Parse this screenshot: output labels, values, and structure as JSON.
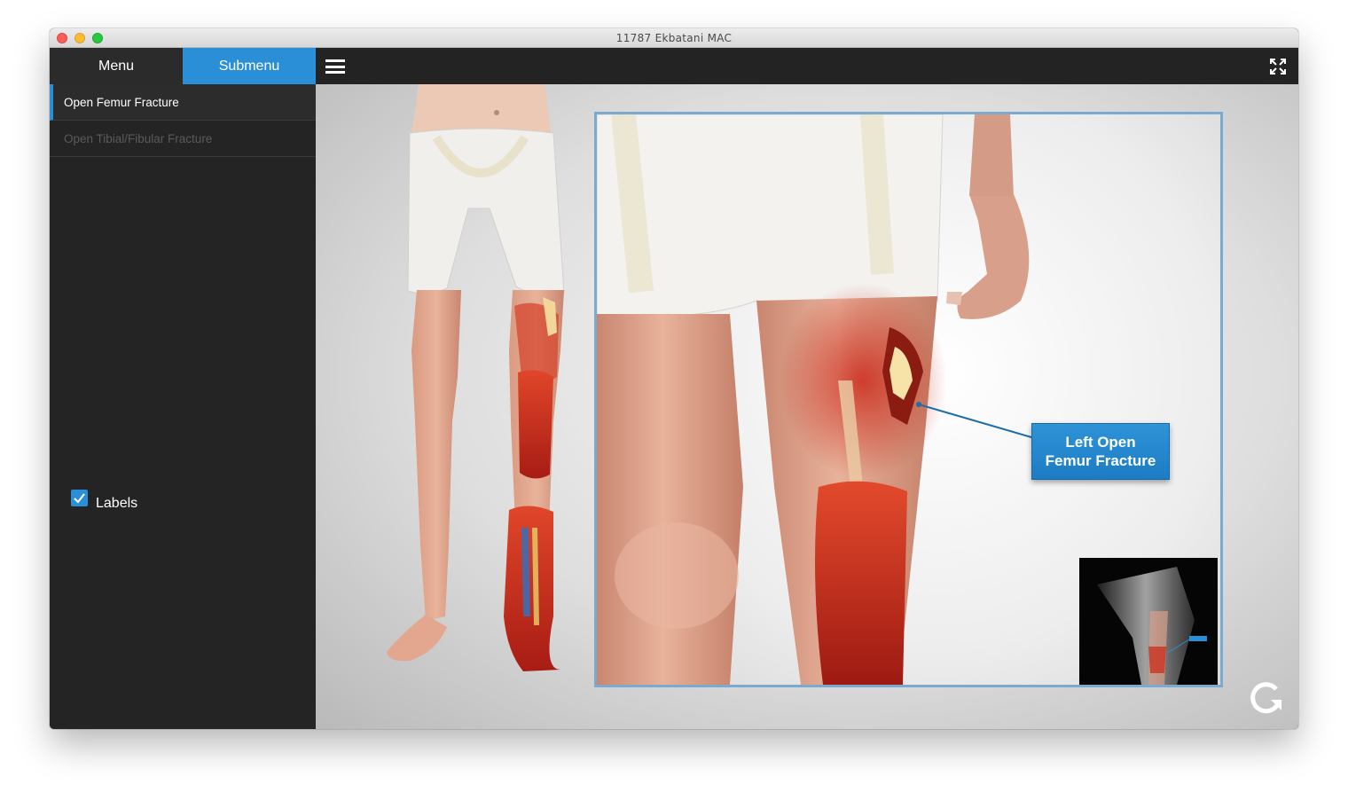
{
  "window": {
    "title": "11787 Ekbatani MAC"
  },
  "tabs": {
    "menu_label": "Menu",
    "submenu_label": "Submenu"
  },
  "sidebar": {
    "items": [
      {
        "label": "Open Femur Fracture",
        "state": "active"
      },
      {
        "label": "Open Tibial/Fibular Fracture",
        "state": "inactive"
      }
    ],
    "labels_checkbox": {
      "label": "Labels",
      "checked": true
    }
  },
  "main": {
    "callout": {
      "line1": "Left Open",
      "line2": "Femur Fracture"
    }
  },
  "icons": {
    "menu": "hamburger-icon",
    "fullscreen": "fullscreen-icon",
    "refresh": "refresh-icon",
    "checkbox": "checkmark-icon"
  },
  "colors": {
    "accent": "#2a8fd6",
    "sidebar_bg": "#242424",
    "callout_bg": "#2a8fd6",
    "frame_border": "#7aaad0"
  }
}
